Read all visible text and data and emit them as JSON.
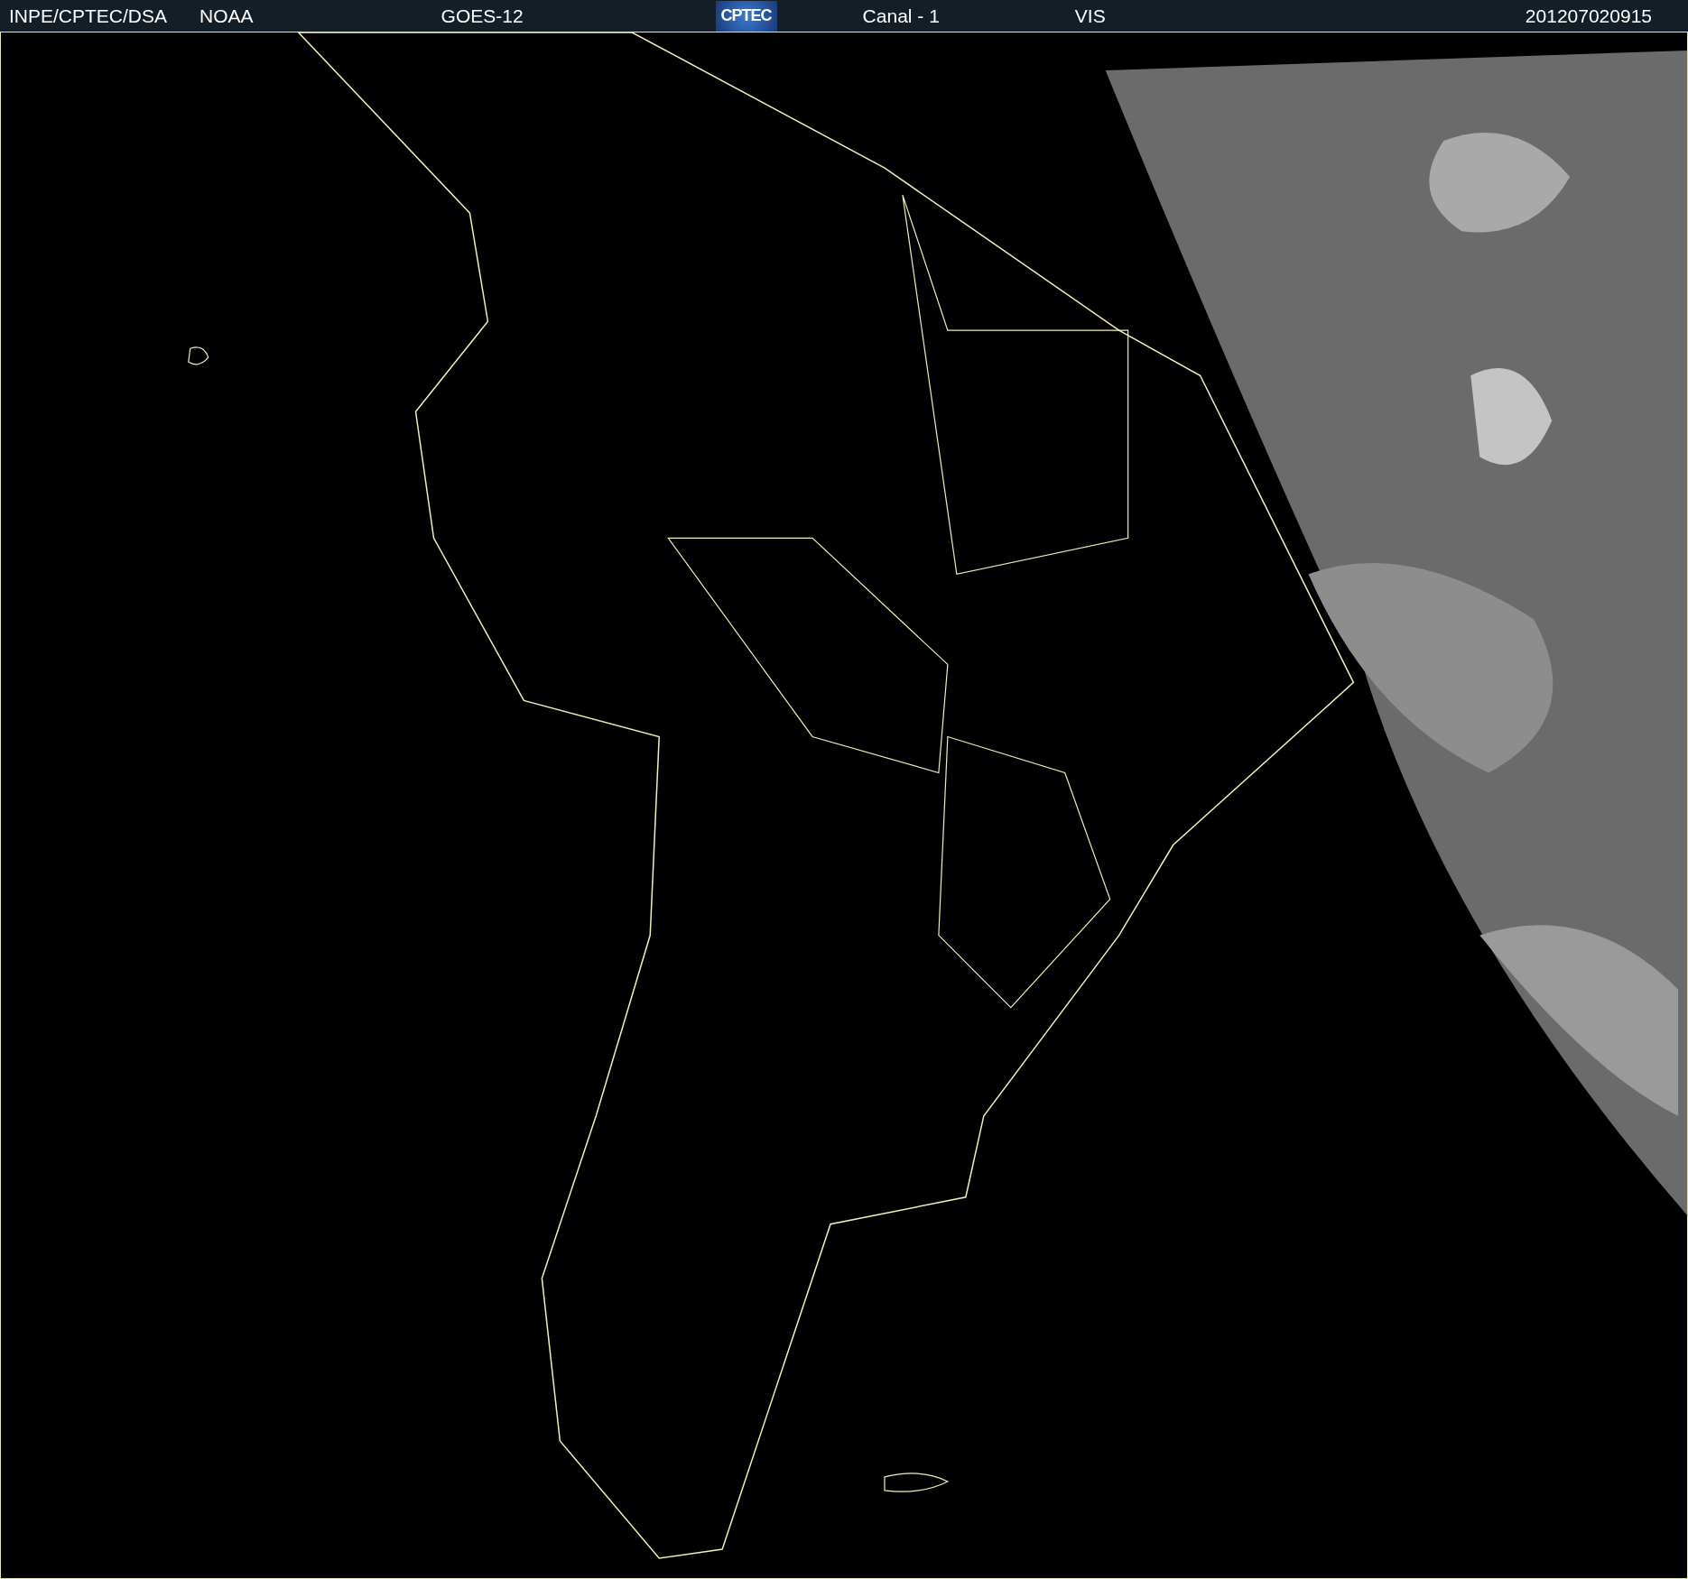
{
  "header": {
    "items": [
      {
        "kind": "text",
        "text": "INPE/CPTEC/DSA"
      },
      {
        "kind": "text",
        "text": "NOAA"
      },
      {
        "kind": "text",
        "text": "GOES-12"
      },
      {
        "kind": "logo",
        "text": "CPTEC"
      },
      {
        "kind": "text",
        "text": "Canal - 1"
      },
      {
        "kind": "text",
        "text": "VIS"
      },
      {
        "kind": "text",
        "text": "201207020915"
      }
    ]
  }
}
